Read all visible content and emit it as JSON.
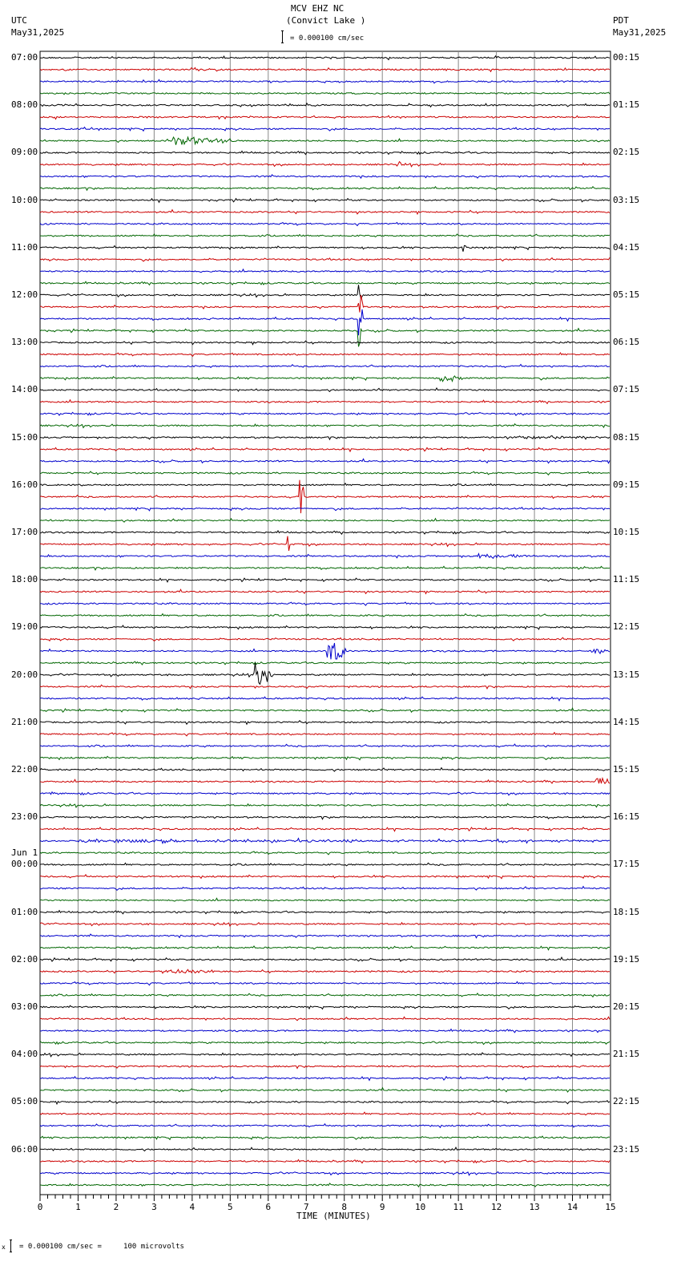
{
  "header": {
    "station": "MCV EHZ NC",
    "location": "(Convict Lake )",
    "left_tz": "UTC",
    "left_date": "May31,2025",
    "right_tz": "PDT",
    "right_date": "May31,2025",
    "scale": "= 0.000100 cm/sec"
  },
  "footer": {
    "scale": "= 0.000100 cm/sec =     100 microvolts",
    "marker": "x"
  },
  "chart_data": {
    "type": "line",
    "title": "MCV EHZ NC (Convict Lake )",
    "xlabel": "TIME (MINUTES)",
    "xlim": [
      0,
      15
    ],
    "xticks": [
      "0",
      "1",
      "2",
      "3",
      "4",
      "5",
      "6",
      "7",
      "8",
      "9",
      "10",
      "11",
      "12",
      "13",
      "14",
      "15"
    ],
    "traces_per_hour": 4,
    "trace_count": 96,
    "trace_colors": [
      "#000000",
      "#cc0000",
      "#0000cc",
      "#006600"
    ],
    "left_labels": [
      "07:00",
      "08:00",
      "09:00",
      "10:00",
      "11:00",
      "12:00",
      "13:00",
      "14:00",
      "15:00",
      "16:00",
      "17:00",
      "18:00",
      "19:00",
      "20:00",
      "21:00",
      "22:00",
      "23:00",
      "00:00",
      "01:00",
      "02:00",
      "03:00",
      "04:00",
      "05:00",
      "06:00"
    ],
    "date_change": {
      "label": "Jun 1",
      "hour_index": 17
    },
    "right_labels": [
      "00:15",
      "01:15",
      "02:15",
      "03:15",
      "04:15",
      "05:15",
      "06:15",
      "07:15",
      "08:15",
      "09:15",
      "10:15",
      "11:15",
      "12:15",
      "13:15",
      "14:15",
      "15:15",
      "16:15",
      "17:15",
      "18:15",
      "19:15",
      "20:15",
      "21:15",
      "22:15",
      "23:15"
    ],
    "events": [
      {
        "trace": 7,
        "start_min": 3.5,
        "dur_min": 1.6,
        "amp": 6
      },
      {
        "trace": 9,
        "start_min": 9.4,
        "dur_min": 0.1,
        "amp": 5
      },
      {
        "trace": 16,
        "start_min": 11.1,
        "dur_min": 0.1,
        "amp": 6
      },
      {
        "trace": 20,
        "start_min": 8.35,
        "dur_min": 0.15,
        "amp": 30
      },
      {
        "trace": 21,
        "start_min": 8.35,
        "dur_min": 0.15,
        "amp": 30
      },
      {
        "trace": 22,
        "start_min": 8.35,
        "dur_min": 0.15,
        "amp": 30
      },
      {
        "trace": 23,
        "start_min": 8.35,
        "dur_min": 0.15,
        "amp": 30
      },
      {
        "trace": 27,
        "start_min": 10.5,
        "dur_min": 0.6,
        "amp": 5
      },
      {
        "trace": 32,
        "start_min": 12.2,
        "dur_min": 2.8,
        "amp": 2
      },
      {
        "trace": 37,
        "start_min": 6.8,
        "dur_min": 0.15,
        "amp": 30
      },
      {
        "trace": 41,
        "start_min": 6.5,
        "dur_min": 0.1,
        "amp": 14
      },
      {
        "trace": 42,
        "start_min": 11.5,
        "dur_min": 1.5,
        "amp": 3
      },
      {
        "trace": 50,
        "start_min": 7.55,
        "dur_min": 0.5,
        "amp": 16
      },
      {
        "trace": 50,
        "start_min": 14.5,
        "dur_min": 0.5,
        "amp": 4
      },
      {
        "trace": 52,
        "start_min": 5.6,
        "dur_min": 0.5,
        "amp": 18
      },
      {
        "trace": 61,
        "start_min": 14.6,
        "dur_min": 0.4,
        "amp": 6
      },
      {
        "trace": 62,
        "start_min": 0.2,
        "dur_min": 0.3,
        "amp": 3
      },
      {
        "trace": 66,
        "start_min": 1.0,
        "dur_min": 14,
        "amp": 1.5
      },
      {
        "trace": 77,
        "start_min": 3.2,
        "dur_min": 1.4,
        "amp": 3
      }
    ]
  }
}
